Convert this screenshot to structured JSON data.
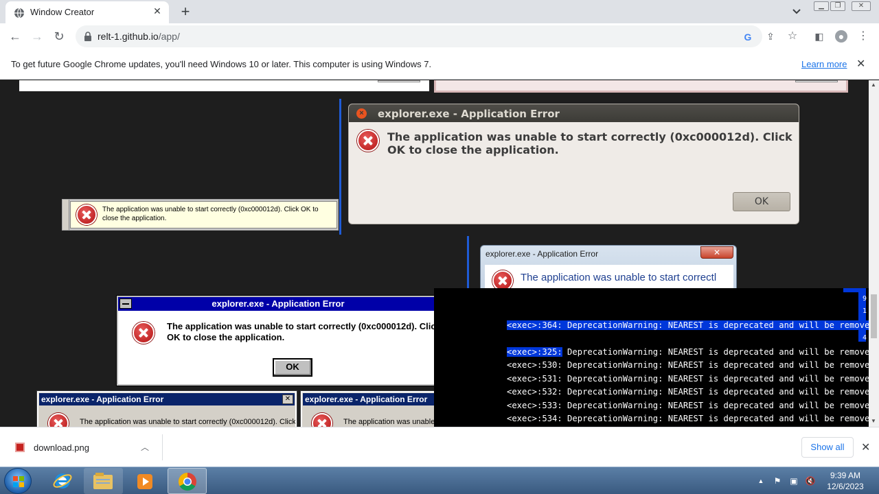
{
  "browser": {
    "tab_title": "Window Creator",
    "url_domain": "relt-1.github.io",
    "url_path": "/app/",
    "infobar_text": "To get future Google Chrome updates, you'll need Windows 10 or later. This computer is using Windows 7.",
    "infobar_link": "Learn more"
  },
  "dialogs": {
    "ubuntu": {
      "title": "explorer.exe - Application Error",
      "message": "The application was unable to start correctly (0xc000012d). Click OK to close the application.",
      "ok": "OK"
    },
    "yellow": {
      "message": "The application was unable to start correctly (0xc000012d). Click OK to close the application."
    },
    "aero": {
      "title": "explorer.exe - Application Error",
      "message": "The application was unable to start correctl"
    },
    "win31": {
      "title": "explorer.exe - Application Error",
      "message": "The application was unable to start correctly (0xc000012d). Click OK to close the application.",
      "ok": "OK"
    },
    "classic_a": {
      "title": "explorer.exe - Application Error",
      "message": "The application was unable to start correctly (0xc000012d). Click"
    },
    "classic_b": {
      "title": "explorer.exe - Application Error",
      "message": "The application was unable"
    }
  },
  "terminal": {
    "lines": [
      {
        "prefix": "<exec>:364:",
        "text": " DeprecationWarning: NEAREST is deprecated and will be removed",
        "highlight": "full"
      },
      {
        "prefix": "<exec>:325:",
        "text": " DeprecationWarning: NEAREST is deprecated and will be removed",
        "highlight": "prefix"
      },
      {
        "prefix": "<exec>:530:",
        "text": " DeprecationWarning: NEAREST is deprecated and will be removed",
        "highlight": "none"
      },
      {
        "prefix": "<exec>:531:",
        "text": " DeprecationWarning: NEAREST is deprecated and will be removed",
        "highlight": "none"
      },
      {
        "prefix": "<exec>:532:",
        "text": " DeprecationWarning: NEAREST is deprecated and will be removed",
        "highlight": "none"
      },
      {
        "prefix": "<exec>:533:",
        "text": " DeprecationWarning: NEAREST is deprecated and will be removed",
        "highlight": "none"
      },
      {
        "prefix": "<exec>:534:",
        "text": " DeprecationWarning: NEAREST is deprecated and will be removed",
        "highlight": "none"
      }
    ],
    "side_digits": [
      "9",
      "1",
      "4"
    ]
  },
  "downloads": {
    "file_name": "download.png",
    "show_all": "Show all"
  },
  "taskbar": {
    "time": "9:39 AM",
    "date": "12/6/2023"
  },
  "colors": {
    "ubuntu_titlebar": "#3c3b37",
    "win31_titlebar": "#0000a8",
    "classic_titlebar": "#0a246a",
    "terminal_selection": "#0037da",
    "link_blue": "#1a73e8"
  }
}
